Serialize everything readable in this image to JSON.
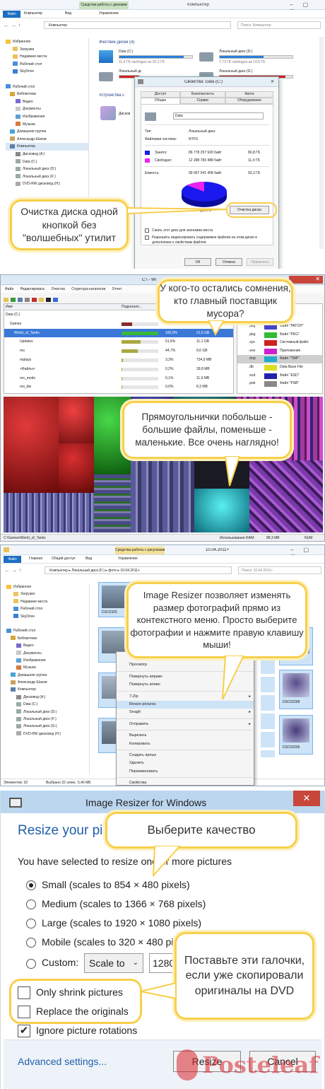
{
  "panel1": {
    "ribbon_tab_disk_tools": "Средства работы с дисками",
    "window_title": "Компьютер",
    "tab_file": "Файл",
    "tab_computer": "Компьютер",
    "tab_view": "Вид",
    "tab_manage": "Управление",
    "address": "Компьютер",
    "search_placeholder": "Поиск: Компьютер",
    "sidebar": [
      "Избранное",
      "Загрузки",
      "Недавние места",
      "Рабочий стол",
      "SkyDrive",
      "",
      "Рабочий стол",
      "Библиотеки",
      "Видео",
      "Документы",
      "Изображения",
      "Музыка",
      "Домашняя группа",
      "Александр Шахов",
      "Компьютер",
      "Дисковод (A:)",
      "Data (C:)",
      "Локальный диск (D:)",
      "Локальный диск (F:)",
      "DVD-RW дисковод (H:)"
    ],
    "group_hdd": "Жесткие диски (4)",
    "group_devices": "Устройства с",
    "drives": [
      {
        "name": "Data (C:)",
        "free": "11,4 ГБ свободно из 92,2 ГБ",
        "fill": 0.88,
        "color": "#2a7fd8"
      },
      {
        "name": "Локальный диск (D:)",
        "free": "7,73 ГБ свободно из 19,5 ГБ",
        "fill": 0.6,
        "color": "#2a7fd8"
      },
      {
        "name": "Локальный диск (F:)",
        "free": "",
        "fill": 0.97,
        "color": "#d02020"
      },
      {
        "name": "Локальный диск (G:)",
        "free": "",
        "fill": 0.9,
        "color": "#d02020"
      }
    ],
    "device_label": "Дисков",
    "dialog": {
      "title": "Свойства: Data (C:)",
      "tabs_row1": [
        "Доступ",
        "Безопасность",
        "Квота"
      ],
      "tabs_row2": [
        "Общие",
        "Сервис",
        "Оборудование"
      ],
      "name": "Data",
      "type_label": "Тип:",
      "type_value": "Локальный диск",
      "fs_label": "Файловая система:",
      "fs_value": "NTFS",
      "used_label": "Занято:",
      "used_bytes": "86 778 257 920 байт",
      "used_gb": "80,8 ГБ",
      "free_label": "Свободно:",
      "free_bytes": "12 288 783 488 байт",
      "free_gb": "11,4 ГБ",
      "cap_label": "Емкость:",
      "cap_bytes": "99 067 041 408 байт",
      "cap_gb": "92,2 ГБ",
      "disk_label": "Диск C",
      "cleanup_button": "Очистка диска",
      "check_compress": "Сжать этот диск для экономии места",
      "check_index": "Разрешить индексировать содержимое файлов на этом диске в дополнение к свойствам файлов",
      "ok": "ОК",
      "cancel": "Отмена",
      "apply": "Применить",
      "used_color": "#1a1aee",
      "free_color": "#ee22ee"
    },
    "bubble": "Очистка диска одной кнопкой без \"волшебных\" утилит"
  },
  "panel2": {
    "window_title": "C:\\ - Wi",
    "menu": [
      "Файл",
      "Редактировать",
      "Очистка",
      "Структура каталогов",
      "Отчет"
    ],
    "col_name": "Имя",
    "col_sub": "Подкатало...",
    "rows": [
      {
        "name": "Data (C:)",
        "pct": "",
        "size": "",
        "bar": 0
      },
      {
        "name": "Games",
        "pct": "28,3%",
        "size": "21,5 GB",
        "bar": 0.28
      },
      {
        "name": "World_of_Tanks",
        "pct": "100,0%",
        "size": "21,5 GB",
        "bar": 1
      },
      {
        "name": "Updates",
        "pct": "51,6%",
        "size": "11,1 GB",
        "bar": 0.52
      },
      {
        "name": "res",
        "pct": "44,7%",
        "size": "9,6 GB",
        "bar": 0.45
      },
      {
        "name": "replays",
        "pct": "3,3%",
        "size": "734,9 MB",
        "bar": 0.03
      },
      {
        "name": "<Файлы>",
        "pct": "0,2%",
        "size": "39,8 MB",
        "bar": 0.01
      },
      {
        "name": "res_mods",
        "pct": "0,1%",
        "size": "11,9 MB",
        "bar": 0.005
      },
      {
        "name": "res_bw",
        "pct": "0,0%",
        "size": "8,3 MB",
        "bar": 0.002
      }
    ],
    "legend": [
      {
        "ext": ".pkg",
        "label": "Файл \"PATCH\"",
        "color": "#4444cc"
      },
      {
        "ext": ".pkg",
        "label": "Файл \"PKG\"",
        "color": "#33bb33"
      },
      {
        "ext": ".sys",
        "label": "Системный файл",
        "color": "#cc2222"
      },
      {
        "ext": ".exe",
        "label": "Приложение",
        "color": "#cc22cc"
      },
      {
        "ext": ".tmp",
        "label": "Файл \"TMP\"",
        "color": "#22aacc"
      },
      {
        "ext": ".db",
        "label": "Data Base File",
        "color": "#dddd22"
      },
      {
        "ext": ".esd",
        "label": "Файл \"ESD\"",
        "color": "#2222aa"
      },
      {
        "ext": ".psb",
        "label": "Файл \"PSB\"",
        "color": "#888888"
      }
    ],
    "status_path": "C:\\Games\\World_of_Tanks",
    "status_ram_label": "Использование RAM:",
    "status_ram": "88,3 MB",
    "status_num": "NUM",
    "bubble_top": "У кого-то остались сомнения, кто главный поставщик мусора?",
    "bubble_mid": "Прямоугольнички побольше - большие файлы, поменьше - маленькие. Все очень наглядно!"
  },
  "panel3": {
    "ribbon_tab_pic_tools": "Средства работы с рисунками",
    "window_title": "10.04.2011+",
    "tabs": [
      "Файл",
      "Главная",
      "Общий доступ",
      "Вид",
      "Управление"
    ],
    "breadcrumb": [
      "Компьютер",
      "Локальный диск (F:)",
      "фото",
      "10.04.2011+"
    ],
    "search_placeholder": "Поиск: 10.04.2011+",
    "sidebar": [
      "Избранное",
      "Загрузки",
      "Недавние места",
      "Рабочий стол",
      "SkyDrive",
      "",
      "Рабочий стол",
      "Библиотеки",
      "Видео",
      "Документы",
      "Изображения",
      "Музыка",
      "Домашняя группа",
      "Александр Шахов",
      "Компьютер",
      "Дисковод (A:)",
      "Data (C:)",
      "Локальный диск (D:)",
      "Локальный диск (F:)",
      "Локальный диск (G:)",
      "DVD-RW дисковод (H:)"
    ],
    "thumbs": [
      "DSC0325",
      "",
      "DSC0267",
      "DSC03268",
      "DSC03286",
      "DSC03296"
    ],
    "status_left": "Элементов: 32",
    "status_sel": "Выбрано 32 элем.: 5,40 МБ",
    "context_menu": [
      "Печать",
      "Просмотр",
      "",
      "Повернуть вправо",
      "Повернуть влево",
      "",
      "7-Zip",
      "Resize pictures",
      "SnagIt",
      "",
      "Отправить",
      "",
      "Вырезать",
      "Копировать",
      "",
      "Создать ярлык",
      "Удалить",
      "Переименовать",
      "",
      "Свойства"
    ],
    "bubble": "Image Resizer позволяет изменять размер фотографий прямо из контекстного меню. Просто выберите фотографии и нажмите правую клавишу мыши!"
  },
  "panel4": {
    "window_title": "Image Resizer for Windows",
    "heading": "Resize your pic",
    "intro": "You have selected to resize one or more pictures",
    "sizes": [
      {
        "label": "Small (scales to 854 × 480 pixels)",
        "checked": true
      },
      {
        "label": "Medium (scales to 1366 × 768 pixels)",
        "checked": false
      },
      {
        "label": "Large (scales to 1920 × 1080 pixels)",
        "checked": false
      },
      {
        "label": "Mobile (scales to 320 × 480 pi",
        "checked": false
      }
    ],
    "custom_label": "Custom:",
    "custom_select": "Scale to",
    "custom_width": "1280",
    "options": [
      {
        "label": "Only shrink pictures",
        "checked": false
      },
      {
        "label": "Replace the originals",
        "checked": false
      },
      {
        "label": "Ignore picture rotations",
        "checked": true
      }
    ],
    "advanced": "Advanced settings...",
    "resize_button": "Resize",
    "cancel_button": "Cancel",
    "bubble_quality": "Выберите качество",
    "bubble_checks": "Поставьте эти галочки, если уже скопировали оригиналы на DVD"
  },
  "watermark": "Posteleaf"
}
